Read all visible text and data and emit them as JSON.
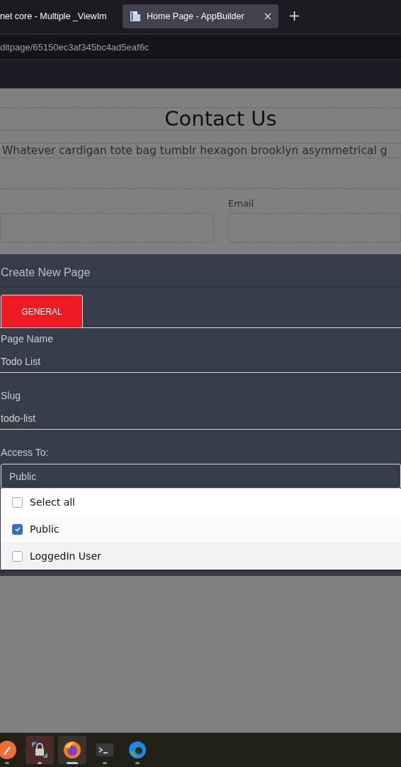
{
  "browser_tabs": [
    {
      "title": "net core - Multiple _ViewIm",
      "selected": false
    },
    {
      "title": "Home Page - AppBuilder",
      "selected": true
    }
  ],
  "address_bar": {
    "url": "ditpage/65150ec3af345bc4ad5eaf6c"
  },
  "page": {
    "heading": "Contact Us",
    "paragraph": "Whatever cardigan tote bag tumblr hexagon brooklyn asymmetrical g",
    "email_label": "Email"
  },
  "dialog": {
    "title": "Create New Page",
    "tabs": [
      {
        "label": "GENERAL",
        "selected": true
      }
    ],
    "fields": [
      {
        "label": "Page Name",
        "value": "Todo List"
      },
      {
        "label": "Slug",
        "value": "todo-list"
      }
    ],
    "access": {
      "label": "Access To:",
      "value": "Public",
      "options": [
        {
          "label": "Select all",
          "checked": false
        },
        {
          "label": "Public",
          "checked": true
        },
        {
          "label": "LoggedIn User",
          "checked": false
        }
      ]
    }
  },
  "taskbar": [
    {
      "kind": "pen",
      "selected": false,
      "attention": false,
      "running": true
    },
    {
      "kind": "lock",
      "selected": false,
      "attention": true,
      "running": true
    },
    {
      "kind": "firefox",
      "selected": true,
      "attention": false,
      "running": true
    },
    {
      "kind": "terminal",
      "selected": false,
      "attention": false,
      "running": true
    },
    {
      "kind": "edge",
      "selected": false,
      "attention": false,
      "running": true
    }
  ]
}
